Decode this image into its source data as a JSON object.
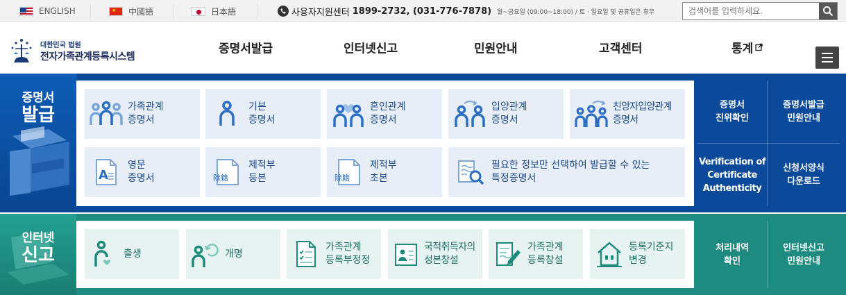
{
  "languages": [
    {
      "label": "ENGLISH",
      "flag": "us-flag-icon"
    },
    {
      "label": "中國語",
      "flag": "china-flag-icon"
    },
    {
      "label": "日本語",
      "flag": "japan-flag-icon"
    }
  ],
  "support": {
    "label": "사용자지원센터",
    "numbers": "1899-2732, (031-776-7878)",
    "hours": "월~금요일 (09:00~18:00) / 토 · 일요일 및 공휴일은 휴무"
  },
  "search": {
    "placeholder": "검색어를 입력하세요."
  },
  "logo": {
    "line1": "대한민국 법원",
    "line2": "전자가족관계등록시스템"
  },
  "nav": {
    "items": [
      "증명서발급",
      "인터넷신고",
      "민원안내",
      "고객센터",
      "통계"
    ]
  },
  "certificate": {
    "title_top": "증명서",
    "title_bottom": "발급",
    "cards": [
      {
        "label": "가족관계\n증명서",
        "icon": "family-icon"
      },
      {
        "label": "기본\n증명서",
        "icon": "person-icon"
      },
      {
        "label": "혼인관계\n증명서",
        "icon": "couple-heart-icon"
      },
      {
        "label": "입양관계\n증명서",
        "icon": "adoption-icon"
      },
      {
        "label": "친양자입양관계\n증명서",
        "icon": "full-adoption-icon"
      },
      {
        "label": "영문\n증명서",
        "icon": "english-doc-icon"
      },
      {
        "label": "제적부\n등본",
        "icon": "removal-register-icon"
      },
      {
        "label": "제적부\n초본",
        "icon": "removal-abstract-icon"
      },
      {
        "label": "필요한 정보만 선택하여 발급할 수 있는\n특정증명서",
        "icon": "magnify-doc-icon"
      }
    ],
    "side": [
      "증명서\n진위확인",
      "증명서발급\n민원안내",
      "Verification of\nCertificate\nAuthenticity",
      "신청서양식\n다운로드"
    ]
  },
  "report": {
    "title_top": "인터넷",
    "title_bottom": "신고",
    "cards": [
      {
        "label": "출생",
        "icon": "birth-icon"
      },
      {
        "label": "개명",
        "icon": "rename-icon"
      },
      {
        "label": "가족관계\n등록부정정",
        "icon": "checklist-icon"
      },
      {
        "label": "국적취득자의\n성본창설",
        "icon": "id-card-icon"
      },
      {
        "label": "가족관계\n등록창설",
        "icon": "doc-edit-icon"
      },
      {
        "label": "등록기준지\n변경",
        "icon": "house-icon"
      }
    ],
    "side": [
      "처리내역\n확인",
      "인터넷신고\n민원안내"
    ]
  },
  "colors": {
    "blue": "#0b4a9a",
    "teal": "#1e8b80"
  }
}
